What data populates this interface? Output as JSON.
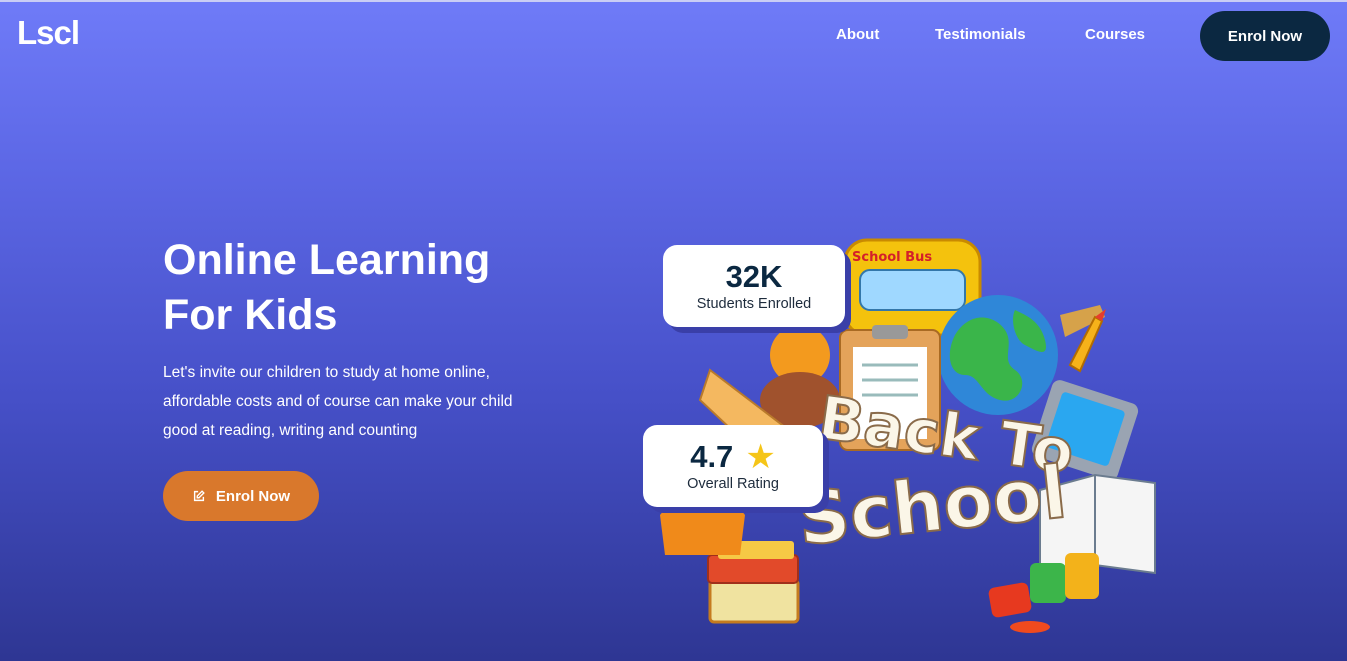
{
  "header": {
    "logo": "Lscl",
    "nav": [
      "About",
      "Testimonials",
      "Courses"
    ],
    "cta_label": "Enrol Now"
  },
  "hero": {
    "title_line1": "Online Learning",
    "title_line2": "For Kids",
    "description_line1": "Let's invite our children to study at home online,",
    "description_line2": "affordable costs and of course can make your child",
    "description_line3": "good at reading, writing and counting",
    "cta_label": "Enrol Now",
    "cta_icon": "edit-icon"
  },
  "stats": {
    "students_value": "32K",
    "students_label": "Students Enrolled",
    "rating_value": "4.7",
    "rating_label": "Overall Rating",
    "rating_icon": "star-icon"
  },
  "illustration": {
    "bus_text": "School Bus",
    "headline_line1": "Back To",
    "headline_line2": "School"
  },
  "colors": {
    "bg_top": "#6f7bf8",
    "bg_bottom": "#2e3693",
    "header_button": "#0b2841",
    "cta_button": "#d9782c",
    "star": "#f5c518"
  }
}
